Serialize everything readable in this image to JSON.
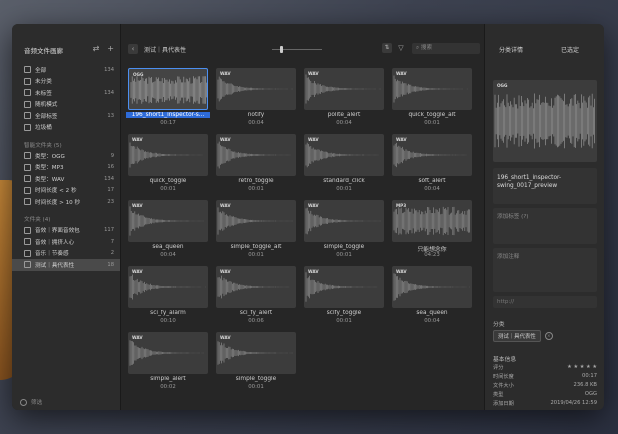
{
  "sidebar": {
    "title": "音频文件画廊",
    "items": [
      {
        "label": "全部",
        "count": "134",
        "icon": "folder-icon"
      },
      {
        "label": "未分类",
        "count": "",
        "icon": "unsorted-icon"
      },
      {
        "label": "未标签",
        "count": "134",
        "icon": "untagged-icon"
      },
      {
        "label": "随机模式",
        "count": "",
        "icon": "random-icon"
      },
      {
        "label": "全部标签",
        "count": "13",
        "icon": "tags-icon"
      },
      {
        "label": "垃圾桶",
        "count": "",
        "icon": "trash-icon"
      }
    ],
    "smart_section": "智能文件夹 (5)",
    "smart_items": [
      {
        "label": "类型：OGG",
        "count": "9"
      },
      {
        "label": "类型：MP3",
        "count": "16"
      },
      {
        "label": "类型：WAV",
        "count": "134"
      },
      {
        "label": "时间长度 < 2 秒",
        "count": "17"
      },
      {
        "label": "时间长度 > 10 秒",
        "count": "23"
      }
    ],
    "folder_section": "文件夹 (4)",
    "folders": [
      {
        "label": "音效｜界面音效包",
        "count": "117"
      },
      {
        "label": "音效｜拥挤人心",
        "count": "7"
      },
      {
        "label": "音乐｜节奏感",
        "count": "2"
      },
      {
        "label": "测试｜具代表性",
        "count": "18"
      }
    ],
    "filter_label": "筛选"
  },
  "toolbar": {
    "title": "测试｜具代表性",
    "search_placeholder": "搜索"
  },
  "tiles": [
    {
      "badge": "OGG",
      "name": "196_short1_inspector-s...",
      "dur": "00:17",
      "selected": true
    },
    {
      "badge": "WAV",
      "name": "notify",
      "dur": "00:04"
    },
    {
      "badge": "WAV",
      "name": "polite_alert",
      "dur": "00:04"
    },
    {
      "badge": "WAV",
      "name": "quick_toggle_alt",
      "dur": "00:01"
    },
    {
      "badge": "WAV",
      "name": "quick_toggle",
      "dur": "00:01"
    },
    {
      "badge": "WAV",
      "name": "retro_toggle",
      "dur": "00:01"
    },
    {
      "badge": "WAV",
      "name": "standard_click",
      "dur": "00:01"
    },
    {
      "badge": "WAV",
      "name": "soft_alert",
      "dur": "00:04"
    },
    {
      "badge": "WAV",
      "name": "sea_queen",
      "dur": "00:04"
    },
    {
      "badge": "WAV",
      "name": "simple_toggle_alt",
      "dur": "00:01"
    },
    {
      "badge": "WAV",
      "name": "simple_toggle",
      "dur": "00:01"
    },
    {
      "badge": "MP3",
      "name": "只能想念你",
      "dur": "04:23"
    },
    {
      "badge": "WAV",
      "name": "sci_fy_alarm",
      "dur": "00:10"
    },
    {
      "badge": "WAV",
      "name": "sci_fy_alert",
      "dur": "00:06"
    },
    {
      "badge": "WAV",
      "name": "scify_toggle",
      "dur": "00:01"
    },
    {
      "badge": "WAV",
      "name": "sea_queen",
      "dur": "00:04"
    },
    {
      "badge": "WAV",
      "name": "simple_alert",
      "dur": "00:02"
    },
    {
      "badge": "WAV",
      "name": "simple_toggle",
      "dur": "00:01"
    }
  ],
  "inspector": {
    "tab_details": "分类详情",
    "tab_selected": "已选定",
    "thumb_badge": "OGG",
    "file_name": "196_short1_inspector-swing_0017_preview",
    "tags_placeholder": "添加标签 (?)",
    "notes_placeholder": "添加注释",
    "url_placeholder": "http://",
    "category_label": "分类",
    "category_chip": "测试｜具代表性",
    "info_label": "基本信息",
    "info": [
      {
        "k": "评分",
        "v": "★ ★ ★ ★ ★"
      },
      {
        "k": "时间长度",
        "v": "00:17"
      },
      {
        "k": "文件大小",
        "v": "236.8 KB"
      },
      {
        "k": "类型",
        "v": "OGG"
      },
      {
        "k": "添加日期",
        "v": "2019/04/26 12:59"
      }
    ]
  },
  "colors": {
    "accent": "#2e6bd8",
    "selection_border": "#4c8ff0"
  }
}
